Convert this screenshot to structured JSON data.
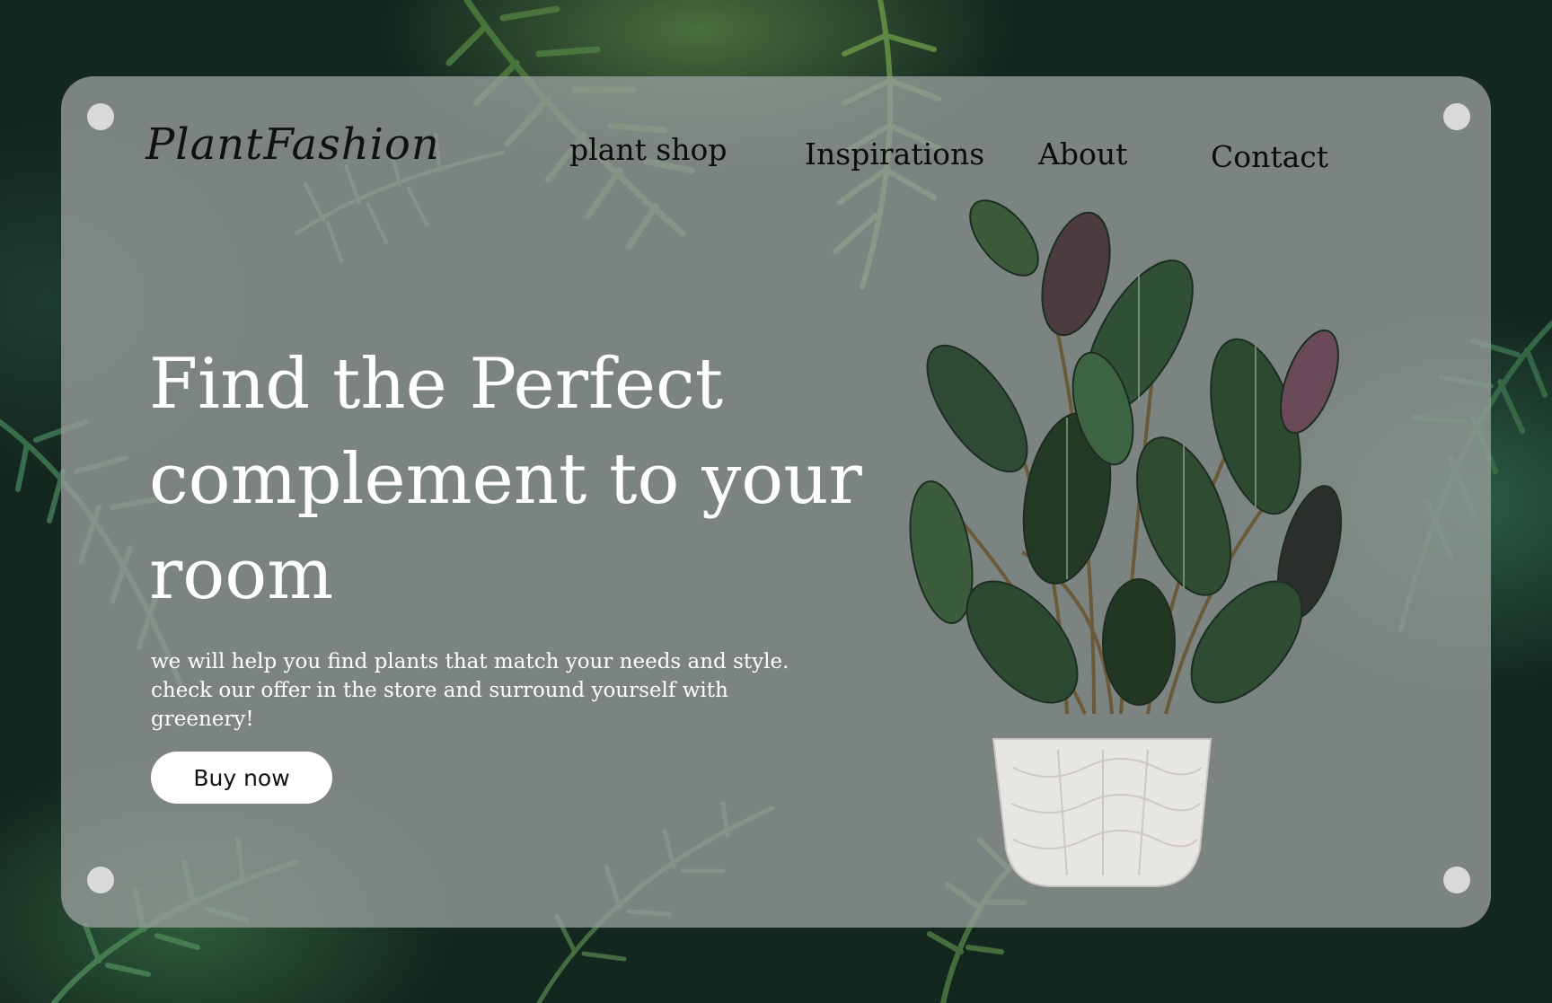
{
  "brand": {
    "logo_text": "PlantFashion"
  },
  "nav": {
    "items": [
      {
        "label": "plant shop"
      },
      {
        "label": "Inspirations"
      },
      {
        "label": "About"
      },
      {
        "label": "Contact"
      }
    ]
  },
  "hero": {
    "title": "Find the Perfect complement to your room",
    "subtitle": "we will help you find plants that match your needs and style. check our offer in the store and surround yourself with greenery!",
    "cta_label": "Buy now"
  },
  "colors": {
    "card_overlay": "#969c9a",
    "background": "#13271f",
    "button": "#ffffff",
    "hero_text": "#ffffff",
    "nav_text": "#0c0c0c",
    "leaf": "#2f4a34",
    "pot": "#e8e6e2"
  },
  "icons": [
    "fern-background-image",
    "potted-plant-image",
    "corner-screw-icon"
  ]
}
